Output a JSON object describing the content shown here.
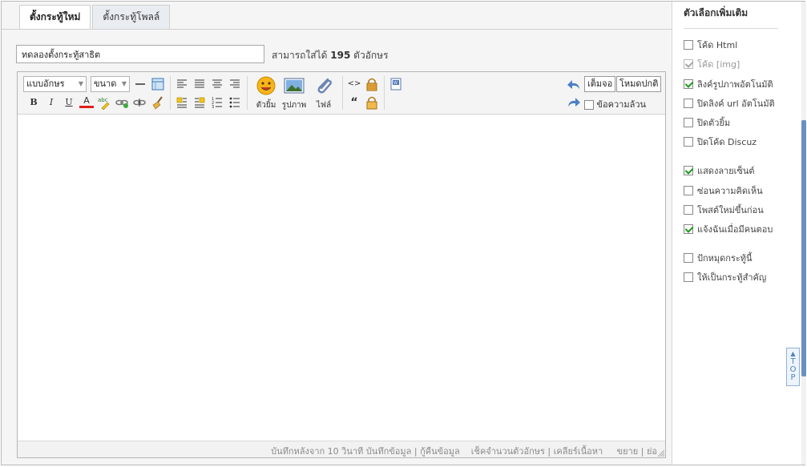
{
  "tabs": [
    {
      "label": "ตั้งกระทู้ใหม่",
      "active": true
    },
    {
      "label": "ตั้งกระทู้โพลล์",
      "active": false
    }
  ],
  "subject": {
    "value": "ทดลองตั้งกระทู้สาธิต",
    "placeholder": ""
  },
  "char_limit": {
    "prefix": "สามารถใส่ได้",
    "count": "195",
    "suffix": "ตัวอักษร"
  },
  "toolbar": {
    "font_select": "แบบอักษร",
    "size_select": "ขนาด",
    "emoticon_label": "ตัวยิ้ม",
    "image_label": "รูปภาพ",
    "file_label": "ไฟล์",
    "fullscreen_label": "เต็มจอ",
    "normal_mode_label": "โหมดปกติ",
    "plaintext_label": "ข้อความล้วน",
    "quote_glyph": "“",
    "code_glyph": "<>",
    "bold": "B",
    "italic": "I",
    "underline": "U",
    "font_color": "A",
    "highlight": "abc"
  },
  "status": {
    "autosave": "บันทึกหลังจาก 10 วินาที",
    "save": "บันทึกข้อมูล",
    "restore": "กู้คืนข้อมูล",
    "check_length": "เช็คจำนวนตัวอักษร",
    "clear": "เคลียร์เนื้อหา",
    "expand": "ขยาย",
    "shrink": "ย่อ",
    "sep": "|"
  },
  "sidebar": {
    "title": "ตัวเลือกเพิ่มเติม",
    "options": [
      {
        "label": "โค้ด Html",
        "checked": false,
        "disabled": false
      },
      {
        "label": "โค้ด [img]",
        "checked": true,
        "disabled": true
      },
      {
        "label": "ลิงค์รูปภาพอัตโนมัติ",
        "checked": true,
        "disabled": false
      },
      {
        "label": "ปิดลิงค์ url อัตโนมัติ",
        "checked": false,
        "disabled": false
      },
      {
        "label": "ปิดตัวยิ้ม",
        "checked": false,
        "disabled": false
      },
      {
        "label": "ปิดโค้ด Discuz",
        "checked": false,
        "disabled": false
      },
      {
        "label": "แสดงลายเซ็นต์",
        "checked": true,
        "disabled": false
      },
      {
        "label": "ซ่อนความคิดเห็น",
        "checked": false,
        "disabled": false
      },
      {
        "label": "โพสต์ใหม่ขึ้นก่อน",
        "checked": false,
        "disabled": false
      },
      {
        "label": "แจ้งฉันเมื่อมีคนตอบ",
        "checked": true,
        "disabled": false
      },
      {
        "label": "ปักหมุดกระทู้นี้",
        "checked": false,
        "disabled": false
      },
      {
        "label": "ให้เป็นกระทู้สำคัญ",
        "checked": false,
        "disabled": false
      }
    ]
  },
  "top_button": {
    "letters": [
      "T",
      "O",
      "P"
    ]
  },
  "colors": {
    "accent_blue": "#4f82c0",
    "check_green": "#1a9a1a",
    "scroll_thumb": "#6b8fc2"
  }
}
